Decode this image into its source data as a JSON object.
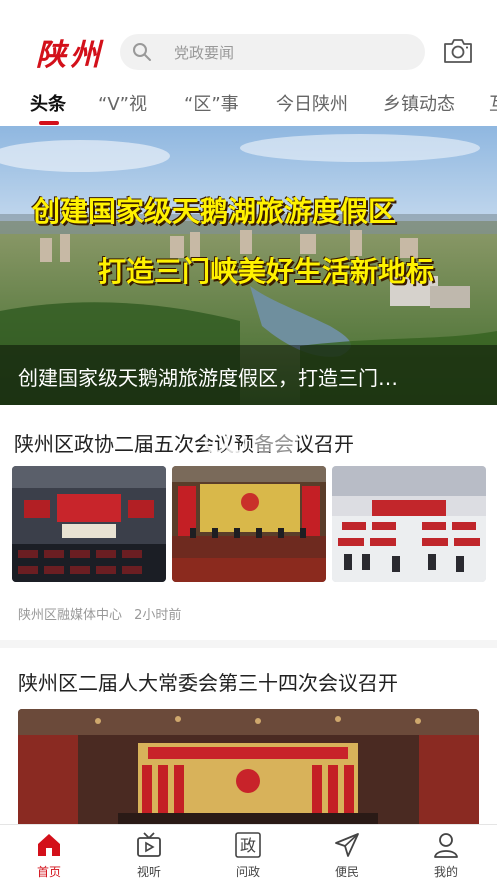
{
  "header": {
    "logo_text": "陕州",
    "search_placeholder": "党政要闻",
    "search_icon": "search-icon",
    "camera_icon": "camera-icon"
  },
  "tabs": [
    {
      "label": "头条",
      "active": true
    },
    {
      "label": "“V”视",
      "active": false
    },
    {
      "label": "“区”事",
      "active": false
    },
    {
      "label": "今日陕州",
      "active": false
    },
    {
      "label": "乡镇动态",
      "active": false
    },
    {
      "label": "互",
      "active": false
    }
  ],
  "banner": {
    "headline_line1": "创建国家级天鹅湖旅游度假区",
    "headline_line2": "打造三门峡美好生活新地标",
    "caption": "创建国家级天鹅湖旅游度假区，打造三门…",
    "colors": {
      "headline": "#fff200"
    }
  },
  "articles": [
    {
      "title": "陕州区政协二届五次会议预备会议召开",
      "source": "陕州区融媒体中心",
      "time": "2小时前"
    },
    {
      "title": "陕州区二届人大常委会第三十四次会议召开"
    }
  ],
  "bottom_nav": [
    {
      "label": "首页",
      "icon": "home-icon",
      "active": true
    },
    {
      "label": "视听",
      "icon": "tv-icon",
      "active": false
    },
    {
      "label": "问政",
      "icon": "zheng-icon",
      "icon_text": "政",
      "active": false
    },
    {
      "label": "便民",
      "icon": "send-icon",
      "active": false
    },
    {
      "label": "我的",
      "icon": "user-icon",
      "active": false
    }
  ],
  "colors": {
    "accent": "#d3101a"
  }
}
